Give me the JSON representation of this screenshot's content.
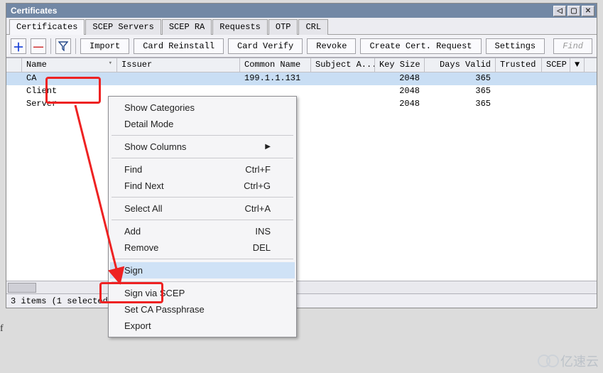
{
  "window": {
    "title": "Certificates"
  },
  "tabs": [
    {
      "label": "Certificates",
      "active": true
    },
    {
      "label": "SCEP Servers"
    },
    {
      "label": "SCEP RA"
    },
    {
      "label": "Requests"
    },
    {
      "label": "OTP"
    },
    {
      "label": "CRL"
    }
  ],
  "titlebar_buttons": {
    "back": "◁",
    "minmax": "▢",
    "close": "✕"
  },
  "toolbar": {
    "plus_icon": "＋",
    "minus_icon": "—",
    "filter_icon": "⫧",
    "import": "Import",
    "card_reinstall": "Card Reinstall",
    "card_verify": "Card Verify",
    "revoke": "Revoke",
    "create_cert_request": "Create Cert. Request",
    "settings": "Settings",
    "find": "Find"
  },
  "columns": {
    "name": "Name",
    "sort_glyph": "▾",
    "issuer": "Issuer",
    "common_name": "Common Name",
    "subject_alt": "Subject A...",
    "key_size": "Key Size",
    "days_valid": "Days Valid",
    "trusted": "Trusted",
    "scep": "SCEP",
    "dropdown": "▼"
  },
  "rows": [
    {
      "name": "CA",
      "issuer": "",
      "common_name": "199.1.1.131",
      "subject_alt": "",
      "key_size": "2048",
      "days_valid": "365",
      "trusted": "",
      "scep": ""
    },
    {
      "name": "Client",
      "issuer": "",
      "common_name": "",
      "subject_alt": "",
      "key_size": "2048",
      "days_valid": "365",
      "trusted": "",
      "scep": ""
    },
    {
      "name": "Server",
      "issuer": "",
      "common_name": "",
      "subject_alt": "",
      "key_size": "2048",
      "days_valid": "365",
      "trusted": "",
      "scep": ""
    }
  ],
  "context_menu": {
    "show_categories": "Show Categories",
    "detail_mode": "Detail Mode",
    "show_columns": "Show Columns",
    "find": "Find",
    "find_short": "Ctrl+F",
    "find_next": "Find Next",
    "find_next_short": "Ctrl+G",
    "select_all": "Select All",
    "select_all_short": "Ctrl+A",
    "add": "Add",
    "add_short": "INS",
    "remove": "Remove",
    "remove_short": "DEL",
    "sign": "Sign",
    "sign_via_scep": "Sign via SCEP",
    "set_ca_passphrase": "Set CA Passphrase",
    "export": "Export",
    "submenu_arrow": "▶"
  },
  "statusbar": {
    "text": "3 items (1 selected)"
  },
  "side_letter": "f",
  "watermark": {
    "text": "亿速云"
  }
}
